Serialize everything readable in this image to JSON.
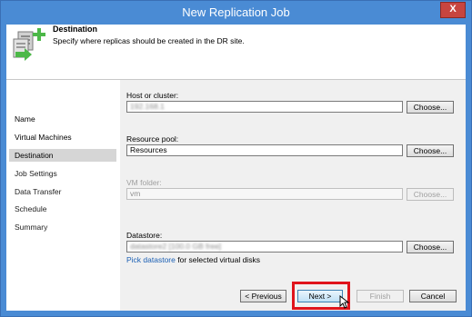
{
  "window": {
    "title": "New Replication Job",
    "close_glyph": "X"
  },
  "header": {
    "title": "Destination",
    "description": "Specify where replicas should be created in the DR site.",
    "icon": "add-replication-icon"
  },
  "nav": {
    "items": [
      {
        "label": "Name"
      },
      {
        "label": "Virtual Machines"
      },
      {
        "label": "Destination"
      },
      {
        "label": "Job Settings"
      },
      {
        "label": "Data Transfer"
      },
      {
        "label": "Schedule"
      },
      {
        "label": "Summary"
      }
    ],
    "active": "Destination"
  },
  "form": {
    "host": {
      "label": "Host or cluster:",
      "value": "192.168.1",
      "button": "Choose..."
    },
    "pool": {
      "label": "Resource pool:",
      "value": "Resources",
      "button": "Choose..."
    },
    "folder": {
      "label": "VM folder:",
      "value": "vm",
      "button": "Choose..."
    },
    "datastore": {
      "label": "Datastore:",
      "value": "datastore2 [100.0 GB free]",
      "button": "Choose..."
    },
    "pick_link": "Pick datastore",
    "pick_suffix": " for selected virtual disks"
  },
  "footer": {
    "previous": "< Previous",
    "next": "Next >",
    "finish": "Finish",
    "cancel": "Cancel"
  },
  "colors": {
    "titlebar": "#4a8bd4",
    "highlight": "#e0141c",
    "link": "#1a5fb4"
  }
}
